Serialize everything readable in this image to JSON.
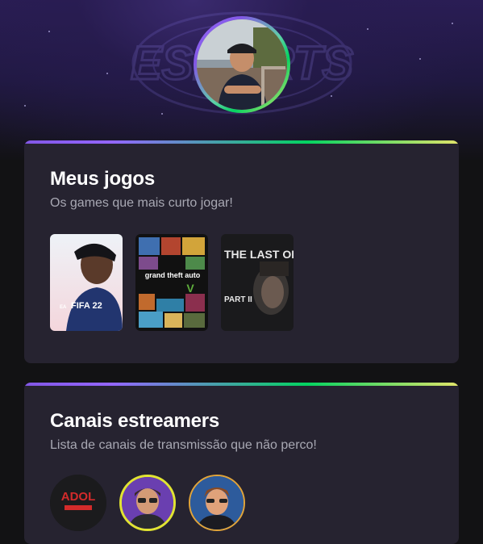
{
  "profile": {
    "avatar_icon": "profile-photo",
    "background_logo_text": "ESPORTS"
  },
  "games_section": {
    "title": "Meus jogos",
    "subtitle": "Os games que mais curto jogar!",
    "games": [
      {
        "icon": "fifa-22-cover",
        "cover_text": "FIFA 22"
      },
      {
        "icon": "gta-v-cover",
        "cover_text": "grand theft auto"
      },
      {
        "icon": "the-last-of-us-2-cover",
        "cover_text": "THE LAST OF US",
        "cover_text_2": "PART II"
      }
    ]
  },
  "streamers_section": {
    "title": "Canais estreamers",
    "subtitle": "Lista de canais de transmissão que não perco!",
    "channels": [
      {
        "icon": "streamer-avatar-1",
        "logo_text": "ADOL"
      },
      {
        "icon": "streamer-avatar-2"
      },
      {
        "icon": "streamer-avatar-3"
      }
    ]
  },
  "colors": {
    "background": "#121214",
    "card": "#262330",
    "accent_purple": "#8257e5",
    "accent_green": "#04d361",
    "accent_yellow": "#e1e46a"
  }
}
